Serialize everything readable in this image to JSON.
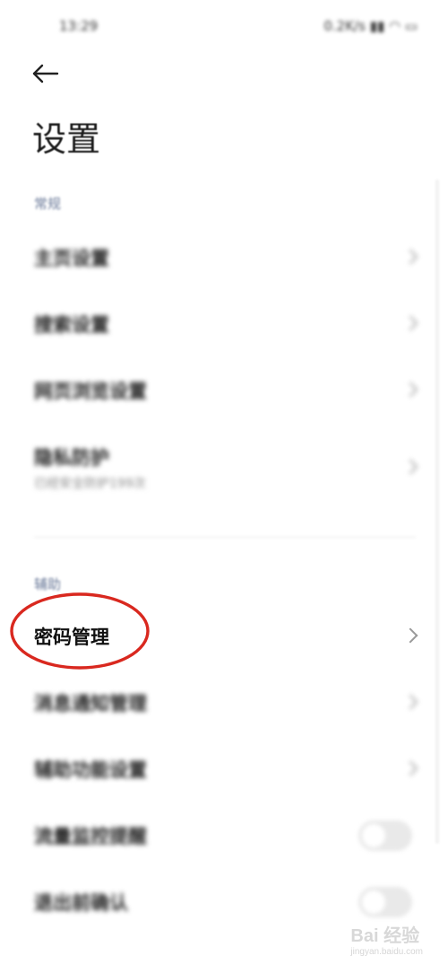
{
  "status_bar": {
    "time": "13:29",
    "right": "0.2K/s ▮▮ ◠ ▭"
  },
  "page": {
    "title": "设置"
  },
  "sections": [
    {
      "label": "常规",
      "items": [
        {
          "label": "主页设置"
        },
        {
          "label": "搜索设置"
        },
        {
          "label": "网页浏览设置"
        },
        {
          "label": "隐私防护",
          "sub": "已经安全防护199次"
        }
      ]
    },
    {
      "label": "辅助",
      "items": [
        {
          "label": "密码管理",
          "highlighted": true
        },
        {
          "label": "消息通知管理"
        },
        {
          "label": "辅助功能设置"
        },
        {
          "label": "流量监控提醒",
          "toggle": false
        },
        {
          "label": "退出前确认",
          "toggle": false
        }
      ]
    }
  ],
  "watermark": {
    "text": "Bai 经验",
    "url": "jingyan.baidu.com"
  },
  "colors": {
    "highlight_circle": "#d9281f",
    "section_label": "#6b7a99"
  }
}
